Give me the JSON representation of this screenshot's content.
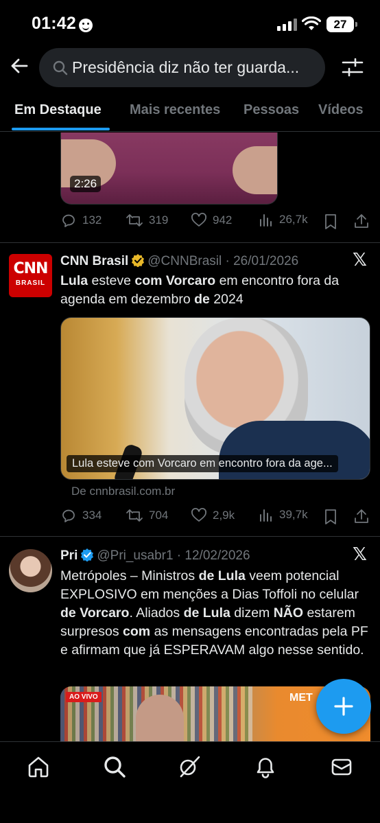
{
  "status_bar": {
    "time": "01:42",
    "battery": "27"
  },
  "search": {
    "query": "Presidência diz não ter guarda..."
  },
  "tabs": [
    {
      "label": "Em Destaque",
      "active": true
    },
    {
      "label": "Mais recentes",
      "active": false
    },
    {
      "label": "Pessoas",
      "active": false
    },
    {
      "label": "Vídeos",
      "active": false
    }
  ],
  "posts": [
    {
      "media": {
        "duration": "2:26"
      },
      "actions": {
        "replies": "132",
        "reposts": "319",
        "likes": "942",
        "views": "26,7k"
      }
    },
    {
      "author": {
        "name": "CNN Brasil",
        "handle": "@CNNBrasil",
        "date": "26/01/2026",
        "avatar_text": "CNN",
        "avatar_sub": "BRASIL"
      },
      "text_parts": [
        {
          "t": "Lula",
          "b": true
        },
        {
          "t": " esteve ",
          "b": false
        },
        {
          "t": "com Vorcaro",
          "b": true
        },
        {
          "t": " em encontro fora da agenda em dezembro ",
          "b": false
        },
        {
          "t": "de",
          "b": true
        },
        {
          "t": " 2024",
          "b": false
        }
      ],
      "card": {
        "caption": "Lula esteve com Vorcaro em encontro fora da age...",
        "source": "De cnnbrasil.com.br"
      },
      "actions": {
        "replies": "334",
        "reposts": "704",
        "likes": "2,9k",
        "views": "39,7k"
      }
    },
    {
      "author": {
        "name": "Pri",
        "handle": "@Pri_usabr1",
        "date": "12/02/2026"
      },
      "text_parts": [
        {
          "t": "Metrópoles – Ministros ",
          "b": false
        },
        {
          "t": "de Lula",
          "b": true
        },
        {
          "t": " veem potencial EXPLOSIVO em menções a Dias Toffoli no celular ",
          "b": false
        },
        {
          "t": "de Vorcaro",
          "b": true
        },
        {
          "t": ". Aliados ",
          "b": false
        },
        {
          "t": "de Lula",
          "b": true
        },
        {
          "t": " dizem ",
          "b": false
        },
        {
          "t": "NÃO",
          "b": true
        },
        {
          "t": " estarem surpresos ",
          "b": false
        },
        {
          "t": "com",
          "b": true
        },
        {
          "t": " as mensagens encontradas pela PF e afirmam que já ESPERAVAM algo nesse sentido.",
          "b": false
        }
      ],
      "media": {
        "badge": "AO VIVO",
        "brand": "MET"
      }
    }
  ],
  "nav": [
    "home-icon",
    "search-icon",
    "grok-icon",
    "notifications-icon",
    "messages-icon"
  ],
  "colors": {
    "accent": "#1d9bf0",
    "background": "#000000",
    "muted": "#71767b",
    "verified": "#1d9bf0"
  }
}
